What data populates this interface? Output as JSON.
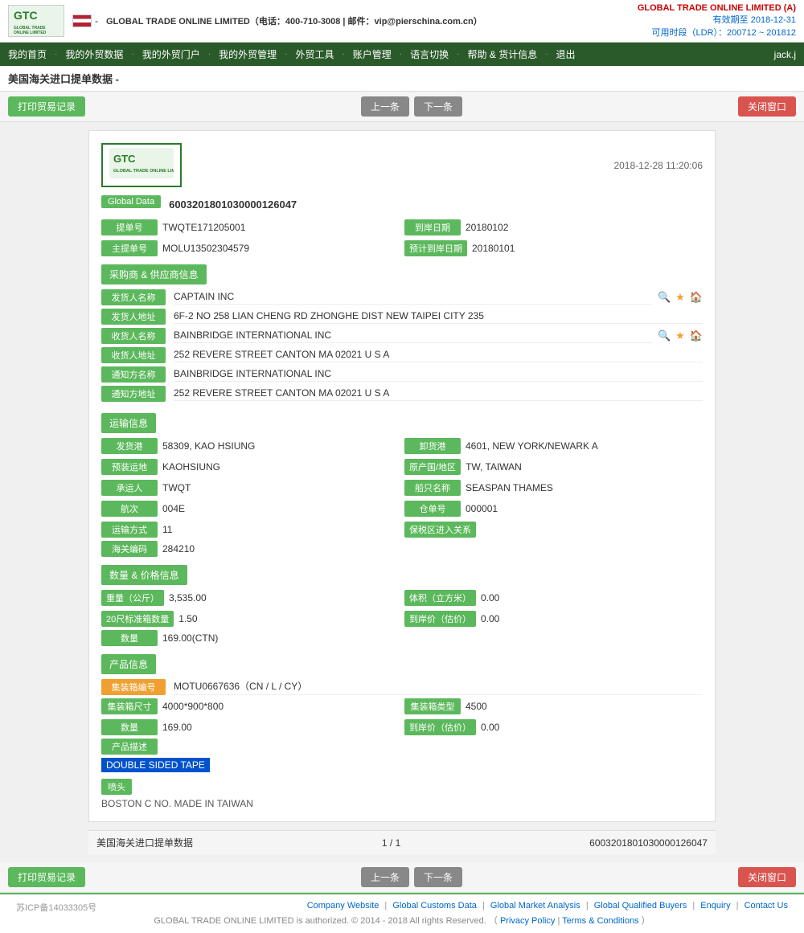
{
  "nav": {
    "items": [
      {
        "label": "我的首页"
      },
      {
        "label": "我的外贸数据"
      },
      {
        "label": "我的外贸门户"
      },
      {
        "label": "我的外贸管理"
      },
      {
        "label": "外贸工具"
      },
      {
        "label": "账户管理"
      },
      {
        "label": "语言切换"
      },
      {
        "label": "帮助 & 货计信息"
      },
      {
        "label": "退出"
      }
    ],
    "user": "jack.j"
  },
  "header": {
    "logo_text": "GTC\nGLOBAL TRADE ONLINE LIMITED",
    "company_name": "GLOBAL TRADE ONLINE LIMITED（电话：400-710-3008 | 邮件：vip@pierschina.com.cn）",
    "account_info": "GLOBAL TRADE ONLINE LIMITED (A)",
    "valid_until": "有效期至 2018-12-31",
    "ldr": "可用时段（LDR）：200712 ~ 201812"
  },
  "page_title": "美国海关进口提单数据 -",
  "toolbar": {
    "print_label": "打印贸易记录",
    "prev_label": "上一条",
    "next_label": "下一条",
    "close_label": "关闭窗口"
  },
  "record": {
    "datetime": "2018-12-28 11:20:06",
    "global_data_label": "Global Data",
    "global_data_value": "6003201801030000126047",
    "bill_no_label": "提单号",
    "bill_no_value": "TWQTE171205001",
    "arrival_date_label": "到岸日期",
    "arrival_date_value": "20180102",
    "master_bill_label": "主提单号",
    "master_bill_value": "MOLU13502304579",
    "est_arrival_label": "预计到岸日期",
    "est_arrival_value": "20180101"
  },
  "buyer_supplier": {
    "section_label": "采购商 & 供应商信息",
    "shipper_name_label": "发货人名称",
    "shipper_name_value": "CAPTAIN INC",
    "shipper_addr_label": "发货人地址",
    "shipper_addr_value": "6F-2 NO 258 LIAN CHENG RD ZHONGHE DIST NEW TAIPEI CITY 235",
    "consignee_name_label": "收货人名称",
    "consignee_name_value": "BAINBRIDGE INTERNATIONAL INC",
    "consignee_addr_label": "收货人地址",
    "consignee_addr_value": "252 REVERE STREET CANTON MA 02021 U S A",
    "notify_name_label": "通知方名称",
    "notify_name_value": "BAINBRIDGE INTERNATIONAL INC",
    "notify_addr_label": "通知方地址",
    "notify_addr_value": "252 REVERE STREET CANTON MA 02021 U S A"
  },
  "transport": {
    "section_label": "运输信息",
    "departure_port_label": "发货港",
    "departure_port_value": "58309, KAO HSIUNG",
    "arrival_port_label": "卸货港",
    "arrival_port_value": "4601, NEW YORK/NEWARK A",
    "pre_transport_label": "预装运地",
    "pre_transport_value": "KAOHSIUNG",
    "origin_region_label": "原产国/地区",
    "origin_region_value": "TW, TAIWAN",
    "carrier_label": "承运人",
    "carrier_value": "TWQT",
    "vessel_name_label": "船只名称",
    "vessel_name_value": "SEASPAN THAMES",
    "voyage_label": "航次",
    "voyage_value": "004E",
    "storage_no_label": "仓单号",
    "storage_no_value": "000001",
    "transport_mode_label": "运输方式",
    "transport_mode_value": "11",
    "bonded_label": "保税区进入关系",
    "bonded_value": "",
    "customs_code_label": "海关编码",
    "customs_code_value": "284210"
  },
  "quantity_price": {
    "section_label": "数量 & 价格信息",
    "weight_label": "重量（公斤）",
    "weight_value": "3,535.00",
    "volume_label": "体积（立方米）",
    "volume_value": "0.00",
    "std20_label": "20尺标准箱数量",
    "std20_value": "1.50",
    "unit_price_label": "到岸价（估价）",
    "unit_price_value": "0.00",
    "quantity_label": "数量",
    "quantity_value": "169.00(CTN)"
  },
  "product": {
    "section_label": "产品信息",
    "container_no_label": "集装箱编号",
    "container_no_value": "MOTU0667636（CN / L / CY）",
    "container_size_label": "集装箱尺寸",
    "container_size_value": "4000*900*800",
    "container_type_label": "集装箱类型",
    "container_type_value": "4500",
    "quantity_label": "数量",
    "quantity_value": "169.00",
    "arrival_price_label": "到岸价（估价）",
    "arrival_price_value": "0.00",
    "desc_label": "产品描述",
    "desc_value": "DOUBLE SIDED TAPE",
    "nozzle_label": "喷头",
    "nozzle_value": "BOSTON C NO. MADE IN TAIWAN"
  },
  "pagination": {
    "source_label": "美国海关进口提单数据",
    "page_info": "1 / 1",
    "record_id": "6003201801030000126047"
  },
  "footer": {
    "icp": "苏ICP备14033305号",
    "links": [
      {
        "label": "Company Website"
      },
      {
        "label": "Global Customs Data"
      },
      {
        "label": "Global Market Analysis"
      },
      {
        "label": "Global Qualified Buyers"
      },
      {
        "label": "Enquiry"
      },
      {
        "label": "Contact Us"
      }
    ],
    "copyright": "GLOBAL TRADE ONLINE LIMITED is authorized. © 2014 - 2018 All rights Reserved.",
    "privacy_label": "Privacy Policy",
    "terms_label": "Terms & Conditions"
  }
}
